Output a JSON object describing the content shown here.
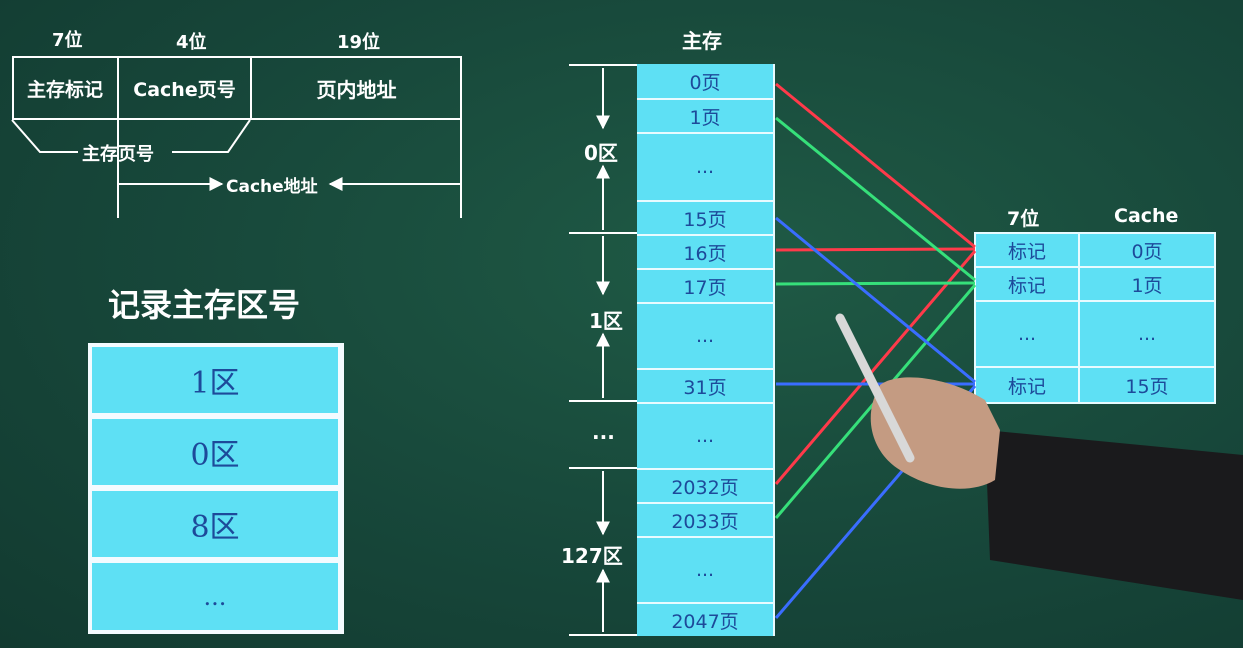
{
  "address_format": {
    "bits": [
      "7位",
      "4位",
      "19位"
    ],
    "fields": [
      "主存标记",
      "Cache页号",
      "页内地址"
    ],
    "main_page_label": "主存页号",
    "cache_addr_label": "Cache地址"
  },
  "record": {
    "title": "记录主存区号",
    "rows": [
      "1区",
      "0区",
      "8区",
      "..."
    ]
  },
  "main_memory": {
    "title": "主存",
    "regions": [
      "0区",
      "1区",
      "...",
      "127区"
    ],
    "pages": [
      "0页",
      "1页",
      "...",
      "15页",
      "16页",
      "17页",
      "...",
      "31页",
      "...",
      "2032页",
      "2033页",
      "...",
      "2047页"
    ]
  },
  "cache": {
    "bits_label": "7位",
    "title": "Cache",
    "tags": [
      "标记",
      "标记",
      "...",
      "标记"
    ],
    "pages": [
      "0页",
      "1页",
      "...",
      "15页"
    ]
  },
  "colors": {
    "red": "#ff3a4a",
    "green": "#36e07a",
    "blue": "#3a6dff",
    "cyan": "#5ee0f4",
    "text_blue": "#1d4a9a"
  }
}
